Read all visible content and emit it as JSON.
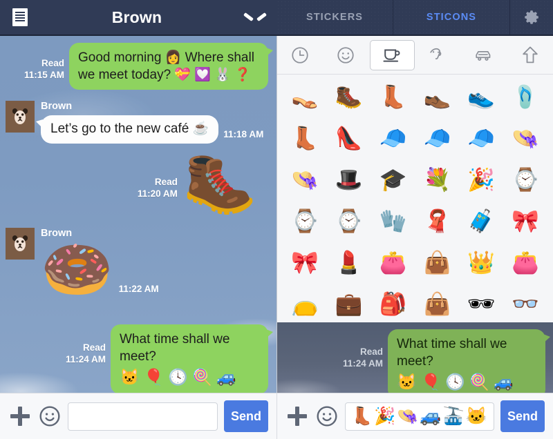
{
  "header": {
    "menu_icon": "hamburger-icon",
    "chat_title": "Brown",
    "chevron_icon": "chevron-down-icon",
    "tabs": [
      {
        "label": "STICKERS",
        "active": false
      },
      {
        "label": "STICONS",
        "active": true
      }
    ],
    "gear_icon": "gear-icon",
    "bar_color": "#303b56",
    "active_tab_color": "#5b8cf5",
    "inactive_tab_color": "#9aa2b4"
  },
  "chat": {
    "background_color": "#7e9bc1",
    "outgoing_bubble_color": "#8ed35f",
    "incoming_bubble_color": "#fdfdfd",
    "messages": [
      {
        "side": "out",
        "type": "text",
        "text_line1": "Good morning 👩 Where shall",
        "text_line2": "we meet today? 💝 💟 🐰 ❓",
        "status": "Read",
        "time": "11:15 AM"
      },
      {
        "side": "in",
        "type": "text",
        "sender": "Brown",
        "avatar_icon": "bear-avatar",
        "text": "Let’s go to the new café ☕",
        "time": "11:18 AM"
      },
      {
        "side": "out",
        "type": "sticker",
        "sticker": "🥾",
        "sticker_name": "yellow-rain-boot-sticker",
        "status": "Read",
        "time": "11:20 AM"
      },
      {
        "side": "in",
        "type": "sticker",
        "sender": "Brown",
        "avatar_icon": "bear-avatar",
        "sticker": "🍩",
        "sticker_name": "pink-donut-sticker",
        "time": "11:22 AM"
      },
      {
        "side": "out",
        "type": "text",
        "text_line1": "What time shall we meet?",
        "text_line2": "🐱 🎈 🕓 🍭 🚙",
        "status": "Read",
        "time": "11:24 AM"
      }
    ]
  },
  "sticker_panel": {
    "categories": [
      {
        "icon": "clock-icon",
        "label": "recent",
        "selected": false
      },
      {
        "icon": "smiley-icon",
        "label": "emotion",
        "selected": false
      },
      {
        "icon": "cup-icon",
        "label": "objects",
        "selected": true
      },
      {
        "icon": "animal-icon",
        "label": "animals",
        "selected": false
      },
      {
        "icon": "car-icon",
        "label": "vehicles",
        "selected": false
      },
      {
        "icon": "arrow-up-icon",
        "label": "symbols",
        "selected": false
      }
    ],
    "stickers": [
      {
        "glyph": "👡",
        "name": "high-heel-sandal-sticker"
      },
      {
        "glyph": "🥾",
        "name": "hiking-boot-sticker"
      },
      {
        "glyph": "👢",
        "name": "yellow-rain-boot-sticker"
      },
      {
        "glyph": "👞",
        "name": "dress-shoe-sticker"
      },
      {
        "glyph": "👟",
        "name": "green-sneaker-sticker"
      },
      {
        "glyph": "🩴",
        "name": "flip-flop-sticker"
      },
      {
        "glyph": "👢",
        "name": "brown-boot-sticker"
      },
      {
        "glyph": "👠",
        "name": "teal-high-heel-sticker"
      },
      {
        "glyph": "🧢",
        "name": "blue-baseball-cap-sticker"
      },
      {
        "glyph": "🧢",
        "name": "orange-visor-sticker"
      },
      {
        "glyph": "🧢",
        "name": "green-flat-cap-sticker"
      },
      {
        "glyph": "👒",
        "name": "straw-boater-hat-sticker"
      },
      {
        "glyph": "👒",
        "name": "sun-hat-sticker"
      },
      {
        "glyph": "🎩",
        "name": "black-fedora-sticker"
      },
      {
        "glyph": "🎓",
        "name": "graduation-cap-sticker"
      },
      {
        "glyph": "💐",
        "name": "flower-headband-sticker"
      },
      {
        "glyph": "🎉",
        "name": "party-hat-sticker"
      },
      {
        "glyph": "⌚",
        "name": "black-watch-sticker"
      },
      {
        "glyph": "⌚",
        "name": "red-digital-watch-sticker"
      },
      {
        "glyph": "⌚",
        "name": "silver-watch-sticker"
      },
      {
        "glyph": "🧤",
        "name": "red-gloves-sticker"
      },
      {
        "glyph": "🧣",
        "name": "blue-scarf-sticker"
      },
      {
        "glyph": "🧳",
        "name": "red-suitcase-sticker"
      },
      {
        "glyph": "🎀",
        "name": "pink-bow-sticker"
      },
      {
        "glyph": "🎀",
        "name": "red-ribbon-bow-sticker"
      },
      {
        "glyph": "💄",
        "name": "lipstick-sticker"
      },
      {
        "glyph": "👛",
        "name": "pink-coin-purse-sticker"
      },
      {
        "glyph": "👜",
        "name": "brown-handbag-sticker"
      },
      {
        "glyph": "👑",
        "name": "gold-crown-sticker"
      },
      {
        "glyph": "👛",
        "name": "brown-wallet-sticker"
      },
      {
        "glyph": "👝",
        "name": "black-clutch-sticker"
      },
      {
        "glyph": "💼",
        "name": "briefcase-sticker"
      },
      {
        "glyph": "🎒",
        "name": "blue-backpack-sticker"
      },
      {
        "glyph": "👜",
        "name": "tote-bag-sticker"
      },
      {
        "glyph": "🕶",
        "name": "black-sunglasses-sticker"
      },
      {
        "glyph": "👓",
        "name": "teal-sunglasses-sticker"
      }
    ]
  },
  "preview": {
    "status": "Read",
    "time": "11:24 AM",
    "text_line1": "What time shall we meet?",
    "text_line2": "🐱 🎈 🕓 🍭 🚙"
  },
  "bottom_bars": {
    "left": {
      "plus_icon": "plus-icon",
      "smiley_icon": "smiley-icon",
      "input_value": "",
      "input_placeholder": "",
      "send_label": "Send"
    },
    "right": {
      "plus_icon": "plus-icon",
      "smiley_icon": "smiley-icon",
      "input_stickers": [
        {
          "glyph": "👢",
          "name": "rain-boot-chip"
        },
        {
          "glyph": "🎉",
          "name": "party-hat-chip"
        },
        {
          "glyph": "👒",
          "name": "straw-hat-chip"
        },
        {
          "glyph": "🚙",
          "name": "blue-car-chip"
        },
        {
          "glyph": "🚠",
          "name": "cable-car-chip"
        },
        {
          "glyph": "🐱",
          "name": "cat-face-chip"
        }
      ],
      "send_label": "Send"
    },
    "send_button_color": "#4a7ae0"
  }
}
